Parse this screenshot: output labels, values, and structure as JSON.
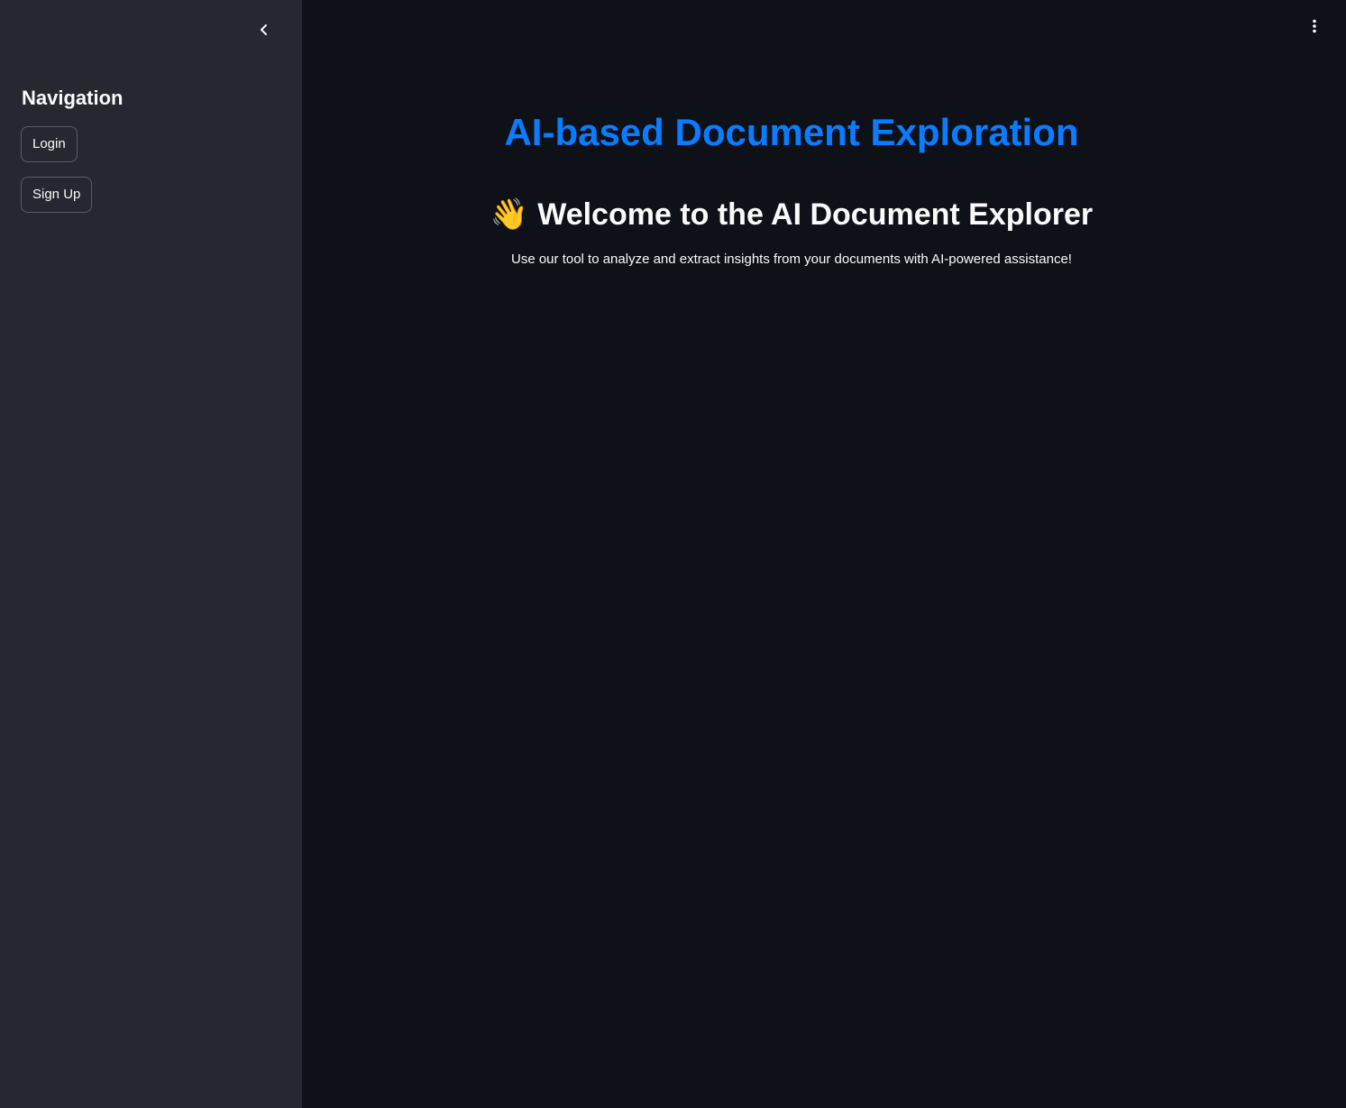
{
  "sidebar": {
    "collapse_icon": "chevron-left-icon",
    "heading": "Navigation",
    "buttons": [
      "Login",
      "Sign Up"
    ]
  },
  "header": {
    "menu_icon": "vertical-ellipsis-icon"
  },
  "main": {
    "title": "AI-based Document Exploration",
    "welcome_emoji": "👋",
    "welcome_text": "Welcome to the AI Document Explorer",
    "subtitle": "Use our tool to analyze and extract insights from your documents with AI-powered assistance!"
  },
  "colors": {
    "sidebar_bg": "#262730",
    "main_bg": "#0e1117",
    "title": "#0a7cff",
    "text": "#fafafa"
  }
}
